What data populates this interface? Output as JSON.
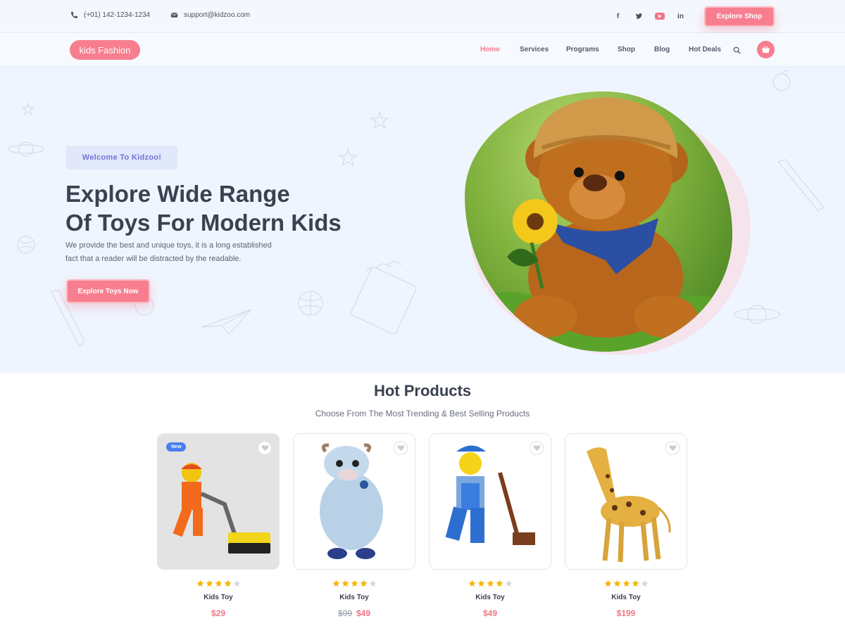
{
  "topbar": {
    "phone": "(+01) 142-1234-1234",
    "email": "support@kidzoo.com",
    "social": [
      "f",
      "t",
      "yt",
      "in"
    ],
    "cta": "Explore Shop"
  },
  "nav": {
    "logo": "kids Fashion",
    "items": [
      "Home",
      "Services",
      "Programs",
      "Shop",
      "Blog",
      "Hot Deals"
    ],
    "active": "Home"
  },
  "hero": {
    "badge": "Welcome To Kidzoo!",
    "title_line1": "Explore Wide Range",
    "title_line2": "Of Toys For Modern Kids",
    "desc_line1": "We provide the best and unique toys, it is a long established",
    "desc_line2": "fact that a reader will be distracted by the readable.",
    "cta": "Explore Toys Now"
  },
  "products_section": {
    "title": "Hot Products",
    "subtitle": "Choose From The Most Trending & Best Selling Products"
  },
  "products": [
    {
      "badge": "New",
      "name": "Kids Toy",
      "old_price": "",
      "price": "$29",
      "rating": 4
    },
    {
      "badge": "",
      "name": "Kids Toy",
      "old_price": "$99",
      "price": "$49",
      "rating": 4
    },
    {
      "badge": "",
      "name": "Kids Toy",
      "old_price": "",
      "price": "$49",
      "rating": 4
    },
    {
      "badge": "",
      "name": "Kids Toy",
      "old_price": "",
      "price": "$199",
      "rating": 4
    }
  ],
  "colors": {
    "accent": "#f77e8e",
    "star": "#f5b400",
    "star_empty": "#d6d8dd",
    "new_badge": "#4a7ef1"
  }
}
